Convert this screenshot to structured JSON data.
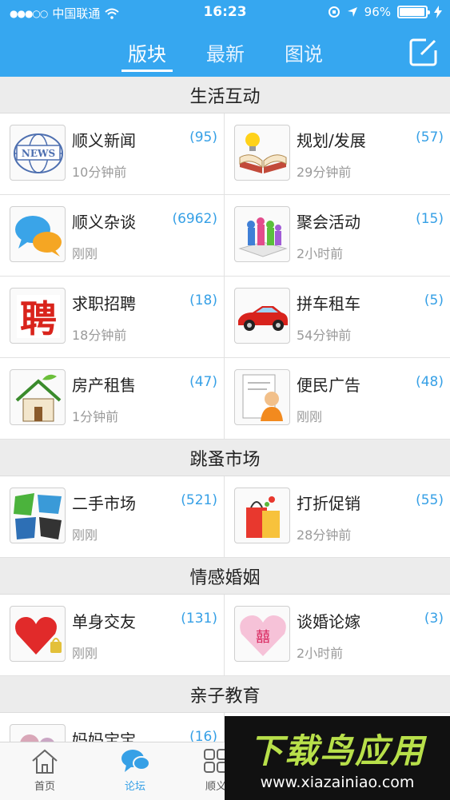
{
  "status_bar": {
    "carrier": "中国联通",
    "time": "16:23",
    "battery": "96%"
  },
  "header": {
    "tabs": [
      {
        "label": "版块"
      },
      {
        "label": "最新"
      },
      {
        "label": "图说"
      }
    ],
    "compose_icon": "compose-icon"
  },
  "sections": [
    {
      "title": "生活互动",
      "items": [
        {
          "name": "顺义新闻",
          "count": "(95)",
          "time": "10分钟前",
          "icon": "news-globe"
        },
        {
          "name": "规划/发展",
          "count": "(57)",
          "time": "29分钟前",
          "icon": "book-bulb"
        },
        {
          "name": "顺义杂谈",
          "count": "(6962)",
          "time": "刚刚",
          "icon": "chat-bubbles"
        },
        {
          "name": "聚会活动",
          "count": "(15)",
          "time": "2小时前",
          "icon": "people-gathering"
        },
        {
          "name": "求职招聘",
          "count": "(18)",
          "time": "18分钟前",
          "icon": "hire-stamp"
        },
        {
          "name": "拼车租车",
          "count": "(5)",
          "time": "54分钟前",
          "icon": "red-car"
        },
        {
          "name": "房产租售",
          "count": "(47)",
          "time": "1分钟前",
          "icon": "house"
        },
        {
          "name": "便民广告",
          "count": "(48)",
          "time": "刚刚",
          "icon": "person-document"
        }
      ]
    },
    {
      "title": "跳蚤市场",
      "items": [
        {
          "name": "二手市场",
          "count": "(521)",
          "time": "刚刚",
          "icon": "secondhand-text"
        },
        {
          "name": "打折促销",
          "count": "(55)",
          "time": "28分钟前",
          "icon": "shopping-bag"
        }
      ]
    },
    {
      "title": "情感婚姻",
      "items": [
        {
          "name": "单身交友",
          "count": "(131)",
          "time": "刚刚",
          "icon": "heart-lock"
        },
        {
          "name": "谈婚论嫁",
          "count": "(3)",
          "time": "2小时前",
          "icon": "pink-heart"
        }
      ]
    },
    {
      "title": "亲子教育",
      "items": [
        {
          "name": "妈妈宝宝",
          "count": "(16)",
          "time": "",
          "icon": "mother-baby"
        }
      ]
    }
  ],
  "tabbar": {
    "items": [
      {
        "label": "首页",
        "icon": "home-icon"
      },
      {
        "label": "论坛",
        "icon": "forum-icon"
      },
      {
        "label": "顺义",
        "icon": "grid-icon"
      }
    ]
  },
  "watermark": {
    "title": "下载鸟应用",
    "url": "www.xiazainiao.com"
  },
  "colors": {
    "accent": "#36a7f0",
    "count": "#36a0e6",
    "section_bg": "#ececec"
  }
}
